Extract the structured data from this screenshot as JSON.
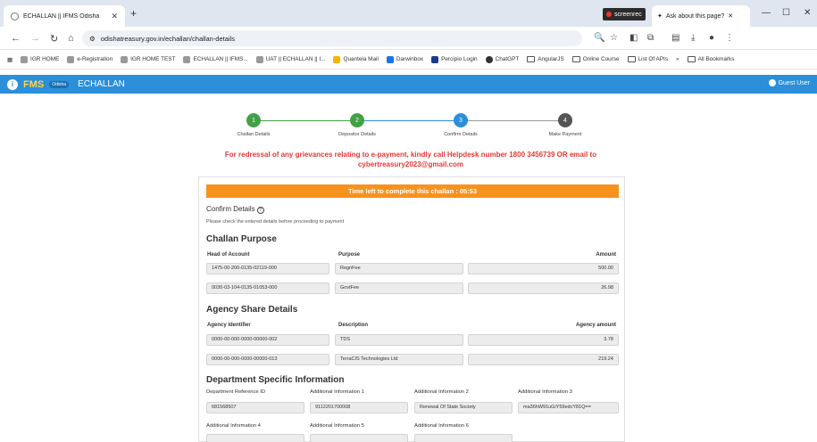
{
  "browser": {
    "tab_title": "ECHALLAN || IFMS Odisha",
    "ask_tab": "Ask about this page?",
    "screenrec": "screenrec",
    "url": "odishatreasury.gov.in/echallan/challan-details",
    "bookmarks": [
      "IGR HOME",
      "e-Registration",
      "IGR HOME TEST",
      "ECHALLAN || IFMS...",
      "UAT || ECHALLAN || I...",
      "Quantela Mail",
      "Darwinbox",
      "Percipio Login",
      "ChatGPT",
      "AngularJS",
      "Online Course",
      "List Of APIs"
    ],
    "all_bookmarks": "All Bookmarks"
  },
  "app": {
    "logo_text": "FMS",
    "logo_sub": "Odisha",
    "title": "ECHALLAN",
    "user": "Guest User"
  },
  "steps": [
    {
      "num": "1",
      "label": "Challan Details",
      "color": "#43a047"
    },
    {
      "num": "2",
      "label": "Depositor Details",
      "color": "#43a047"
    },
    {
      "num": "3",
      "label": "Confirm Details",
      "color": "#2b8fd9"
    },
    {
      "num": "4",
      "label": "Make Payment",
      "color": "#555555"
    }
  ],
  "notice": "For redressal of any grievances relating to e-payment, kindly call Helpdesk number 1800 3456739 OR email to cybertreasury2023@gmail.com",
  "timer": "Time left to complete this challan :  05:53",
  "confirm": {
    "title": "Confirm Details",
    "subtitle": "Please check the entered details before proceeding to payment"
  },
  "challan_purpose": {
    "heading": "Challan Purpose",
    "col_head": "Head of Account",
    "col_purpose": "Purpose",
    "col_amount": "Amount",
    "rows": [
      {
        "head": "1475-00-200-0135-02119-000",
        "purpose": "RegnFee",
        "amount": "500.00"
      },
      {
        "head": "0030-03-104-0135-01053-000",
        "purpose": "GovtFee",
        "amount": "26.98"
      }
    ]
  },
  "agency": {
    "heading": "Agency Share Details",
    "col_id": "Agency Identifier",
    "col_desc": "Description",
    "col_amount": "Agency amount",
    "rows": [
      {
        "id": "0000-00-000-0000-00000-002",
        "desc": "TDS",
        "amount": "3.78"
      },
      {
        "id": "0000-00-000-0000-00000-013",
        "desc": "TerraCIS Technologies Ltd",
        "amount": "219.24"
      }
    ]
  },
  "dept": {
    "heading": "Department Specific Information",
    "labels": [
      "Department Reference ID",
      "Additional Information 1",
      "Additional Information 2",
      "Additional Information 3"
    ],
    "values": [
      "681568507",
      "9112201700008",
      "Renewal Of State Society",
      "ma36hW91uGiY59edcY81Q=="
    ],
    "labels2": [
      "Additional Information 4",
      "Additional Information 5",
      "Additional Information 6"
    ],
    "values2": [
      "",
      "",
      ""
    ]
  }
}
